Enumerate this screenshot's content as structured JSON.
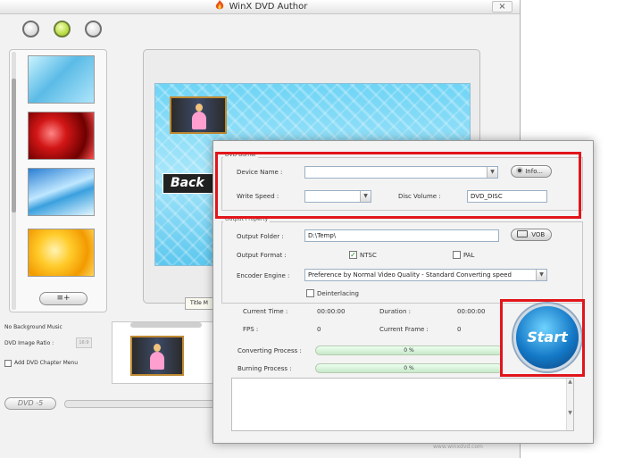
{
  "window": {
    "title": "WinX DVD Author",
    "close": "×"
  },
  "sidebar": {
    "add_menu_icon": "≡+"
  },
  "preview": {
    "back_button": "Back",
    "tab_title_menu": "Title M"
  },
  "options": {
    "background_music": "No Background Music",
    "image_ratio_label": "DVD Image Ratio :",
    "image_ratio_value": "16:9",
    "chapter_menu_label": "Add DVD Chapter Menu"
  },
  "disc": {
    "size_label": "DVD -5"
  },
  "dialog": {
    "dvd_burner": {
      "title": "DVD Burner",
      "device_label": "Device Name :",
      "device_value": "",
      "info_button": "Info...",
      "speed_label": "Write Speed :",
      "speed_value": "",
      "volume_label": "Disc Volume :",
      "volume_value": "DVD_DISC"
    },
    "output": {
      "title": "Output Property",
      "folder_label": "Output Folder :",
      "folder_value": "D:\\Temp\\",
      "vob_button": "VOB",
      "format_label": "Output Format :",
      "ntsc_label": "NTSC",
      "ntsc_checked": "✓",
      "pal_label": "PAL",
      "engine_label": "Encoder Engine :",
      "engine_value": "Preference by Normal Video Quality - Standard Converting speed",
      "deinterlacing_label": "Deinterlacing"
    },
    "status": {
      "current_time_label": "Current Time :",
      "current_time_value": "00:00:00",
      "duration_label": "Duration :",
      "duration_value": "00:00:00",
      "fps_label": "FPS :",
      "fps_value": "0",
      "current_frame_label": "Current Frame :",
      "current_frame_value": "0",
      "converting_label": "Converting Process :",
      "converting_value": "0 %",
      "burning_label": "Burning Process :",
      "burning_value": "0 %"
    },
    "start_button": "Start",
    "watermark": "www.winxdvd.com"
  },
  "colors": {
    "highlight": "#e1151b",
    "start": "#1479c7"
  }
}
